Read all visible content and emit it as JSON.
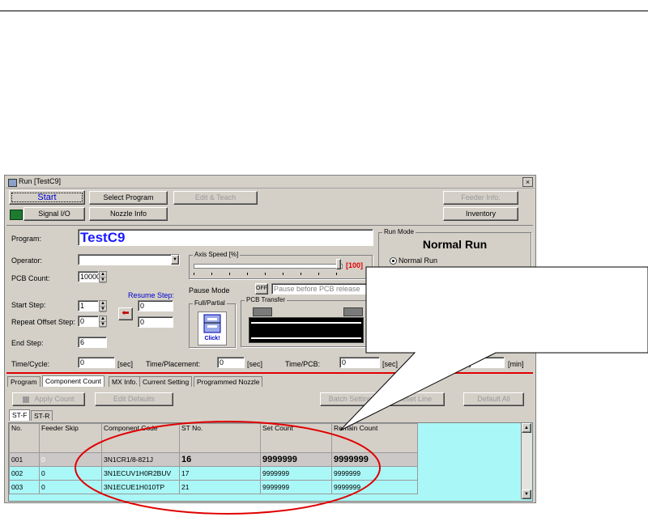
{
  "window": {
    "title": "Run [TestC9]",
    "close": "×"
  },
  "toolbar": {
    "start": "Start",
    "select_program": "Select Program",
    "edit_teach": "Edit & Teach",
    "feeder_info": "Feeder Info.",
    "inventory": "Inventory",
    "signal_io": "Signal I/O",
    "nozzle_info": "Nozzle Info"
  },
  "form": {
    "program_label": "Program:",
    "program_value": "TestC9",
    "operator_label": "Operator:",
    "operator_value": "",
    "pcb_count_label": "PCB Count:",
    "pcb_count_value": "10000",
    "start_step_label": "Start Step:",
    "start_step_value": "1",
    "repeat_offset_label": "Repeat Offset Step:",
    "repeat_offset_value": "0",
    "end_step_label": "End Step:",
    "end_step_value": "6",
    "resume_step_label": "Resume Step:",
    "resume_step_value1": "0",
    "resume_step_value2": "0"
  },
  "axis_speed": {
    "label": "Axis Speed [%]",
    "value_text": "[100]",
    "value": 100
  },
  "pause_mode": {
    "label": "Pause Mode",
    "toggle": "OFF",
    "option": "Pause before PCB release"
  },
  "full_partial": {
    "label": "Full/Partial",
    "click": "Click!"
  },
  "pcb_transfer": {
    "label": "PCB Transfer"
  },
  "run_mode": {
    "label": "Run Mode",
    "value": "Normal Run",
    "option": "Normal Run"
  },
  "times": {
    "cycle_label": "Time/Cycle:",
    "cycle_value": "0",
    "cycle_unit": "[sec]",
    "placement_label": "Time/Placement:",
    "placement_value": "0",
    "placement_unit": "[sec]",
    "pcb_label": "Time/PCB:",
    "pcb_value": "0",
    "pcb_unit": "[sec]",
    "min_unit": "[min]"
  },
  "tabs": [
    "Program",
    "Component Count",
    "MX Info.",
    "Current Setting",
    "Programmed Nozzle"
  ],
  "count_toolbar": {
    "apply_count": "Apply Count",
    "edit_defaults": "Edit Defaults",
    "batch_setting": "Batch Setting",
    "reset_line": "Reset Line",
    "default_all": "Default All"
  },
  "subtabs": [
    "ST-F",
    "ST-R"
  ],
  "table": {
    "headers": [
      "No.",
      "Feeder Skip",
      "Component Code",
      "ST No.",
      "Set Count",
      "Remain Count"
    ],
    "rows": [
      [
        "001",
        "0",
        "3N1CR1/8-821J",
        "16",
        "9999999",
        "9999999"
      ],
      [
        "002",
        "0",
        "3N1ECUV1H0R2BUV",
        "17",
        "9999999",
        "9999999"
      ],
      [
        "003",
        "0",
        "3N1ECUE1H010TP",
        "21",
        "9999999",
        "9999999"
      ]
    ]
  },
  "colors": {
    "callout_ellipse": "#e00000",
    "grid_row": "#aaf7f7",
    "title_blue": "#1a1aff"
  }
}
